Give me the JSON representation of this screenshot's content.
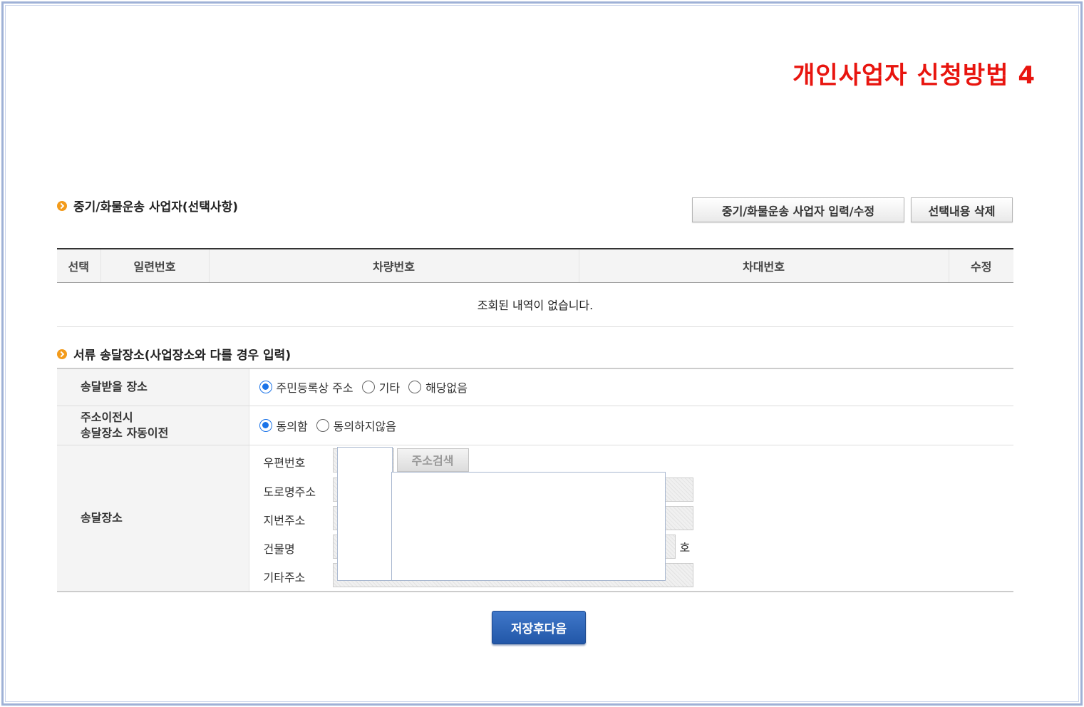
{
  "page_title": "개인사업자 신청방법 4",
  "section1": {
    "heading": "중기/화물운송 사업자(선택사항)",
    "btn_edit": "중기/화물운송 사업자 입력/수정",
    "btn_delete": "선택내용 삭제",
    "columns": [
      "선택",
      "일련번호",
      "차량번호",
      "차대번호",
      "수정"
    ],
    "empty_message": "조회된 내역이 없습니다."
  },
  "section2": {
    "heading": "서류 송달장소(사업장소와 다를 경우 입력)",
    "row1": {
      "label": "송달받을 장소",
      "options": [
        "주민등록상 주소",
        "기타",
        "해당없음"
      ],
      "selected": "주민등록상 주소"
    },
    "row2": {
      "label_line1": "주소이전시",
      "label_line2": "송달장소 자동이전",
      "options": [
        "동의함",
        "동의하지않음"
      ],
      "selected": "동의함"
    },
    "row3": {
      "label": "송달장소",
      "fields": [
        "우편번호",
        "도로명주소",
        "지번주소",
        "건물명",
        "기타주소"
      ],
      "search_button": "주소검색",
      "ho_suffix": "호"
    }
  },
  "save_button": "저장후다음",
  "colors": {
    "title_red": "#e8150f",
    "accent_blue": "#2f67b8",
    "bullet_orange": "#f39b1b"
  }
}
